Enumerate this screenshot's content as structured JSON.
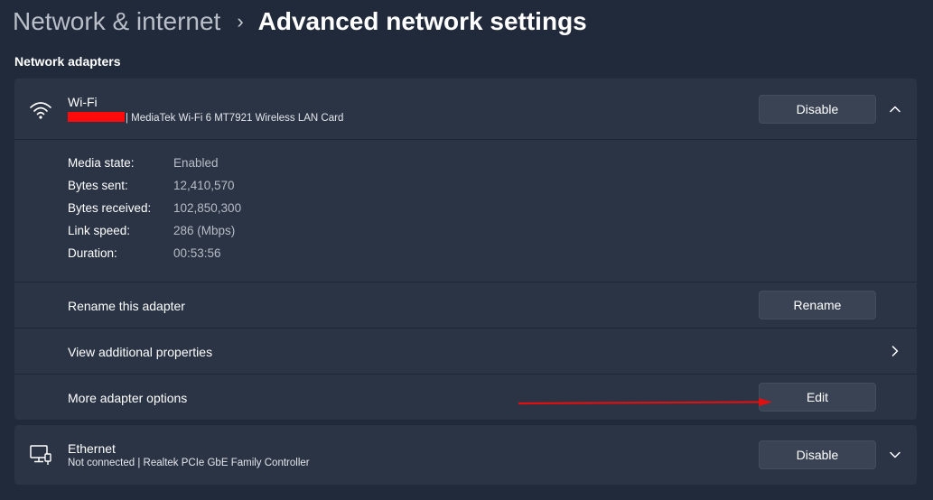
{
  "breadcrumb": {
    "parent": "Network & internet",
    "separator": "›",
    "current": "Advanced network settings"
  },
  "section": {
    "title": "Network adapters"
  },
  "wifi": {
    "name": "Wi-Fi",
    "description": "| MediaTek Wi-Fi 6 MT7921 Wireless LAN Card",
    "disable_label": "Disable",
    "icon": "wifi-icon",
    "expanded": true,
    "details": [
      {
        "label": "Media state:",
        "value": "Enabled"
      },
      {
        "label": "Bytes sent:",
        "value": "12,410,570"
      },
      {
        "label": "Bytes received:",
        "value": "102,850,300"
      },
      {
        "label": "Link speed:",
        "value": "286 (Mbps)"
      },
      {
        "label": "Duration:",
        "value": "00:53:56"
      }
    ],
    "rename": {
      "label": "Rename this adapter",
      "button": "Rename"
    },
    "additional": {
      "label": "View additional properties"
    },
    "more": {
      "label": "More adapter options",
      "button": "Edit"
    }
  },
  "ethernet": {
    "name": "Ethernet",
    "description": "Not connected | Realtek PCIe GbE Family Controller",
    "disable_label": "Disable",
    "icon": "ethernet-icon",
    "expanded": false
  },
  "colors": {
    "background": "#202a3a",
    "card": "#2b3445",
    "button": "#3a4354",
    "annotation_arrow": "#e01010",
    "redaction": "#ff0a0a"
  }
}
